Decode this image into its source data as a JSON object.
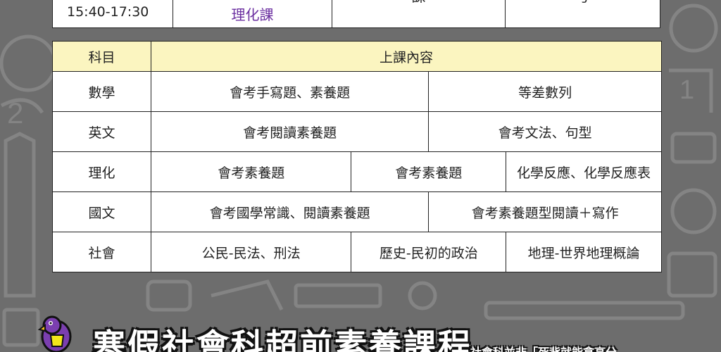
{
  "top_row": {
    "time": "15:40-17:30",
    "subject": "理化課",
    "col3": "課",
    "col4": "号"
  },
  "table": {
    "header": {
      "subject": "科目",
      "content": "上課內容"
    },
    "rows": [
      {
        "subject": "數學",
        "cells": [
          "會考手寫題、素養題",
          "等差數列"
        ]
      },
      {
        "subject": "英文",
        "cells": [
          "會考閱讀素養題",
          "會考文法、句型"
        ]
      },
      {
        "subject": "理化",
        "cells": [
          "會考素養題",
          "會考素養題",
          "化學反應、化學反應表"
        ]
      },
      {
        "subject": "國文",
        "cells": [
          "會考國學常識、閱讀素養題",
          "會考素養題型閱讀＋寫作"
        ]
      },
      {
        "subject": "社會",
        "cells": [
          "公民-民法、刑法",
          "歷史-民初的政治",
          "地理-世界地理概論"
        ]
      }
    ]
  },
  "banner": {
    "title": "寒假社會科超前素養課程",
    "note": "社會科並非「死背就能拿高分"
  },
  "colors": {
    "background": "#6d6d6d",
    "header_fill": "#fbf5c0",
    "math": "#e0197a",
    "english": "#1d9ad6",
    "science": "#6b2fa0",
    "chinese": "#1f7a3a",
    "social": "#9a5a22"
  }
}
